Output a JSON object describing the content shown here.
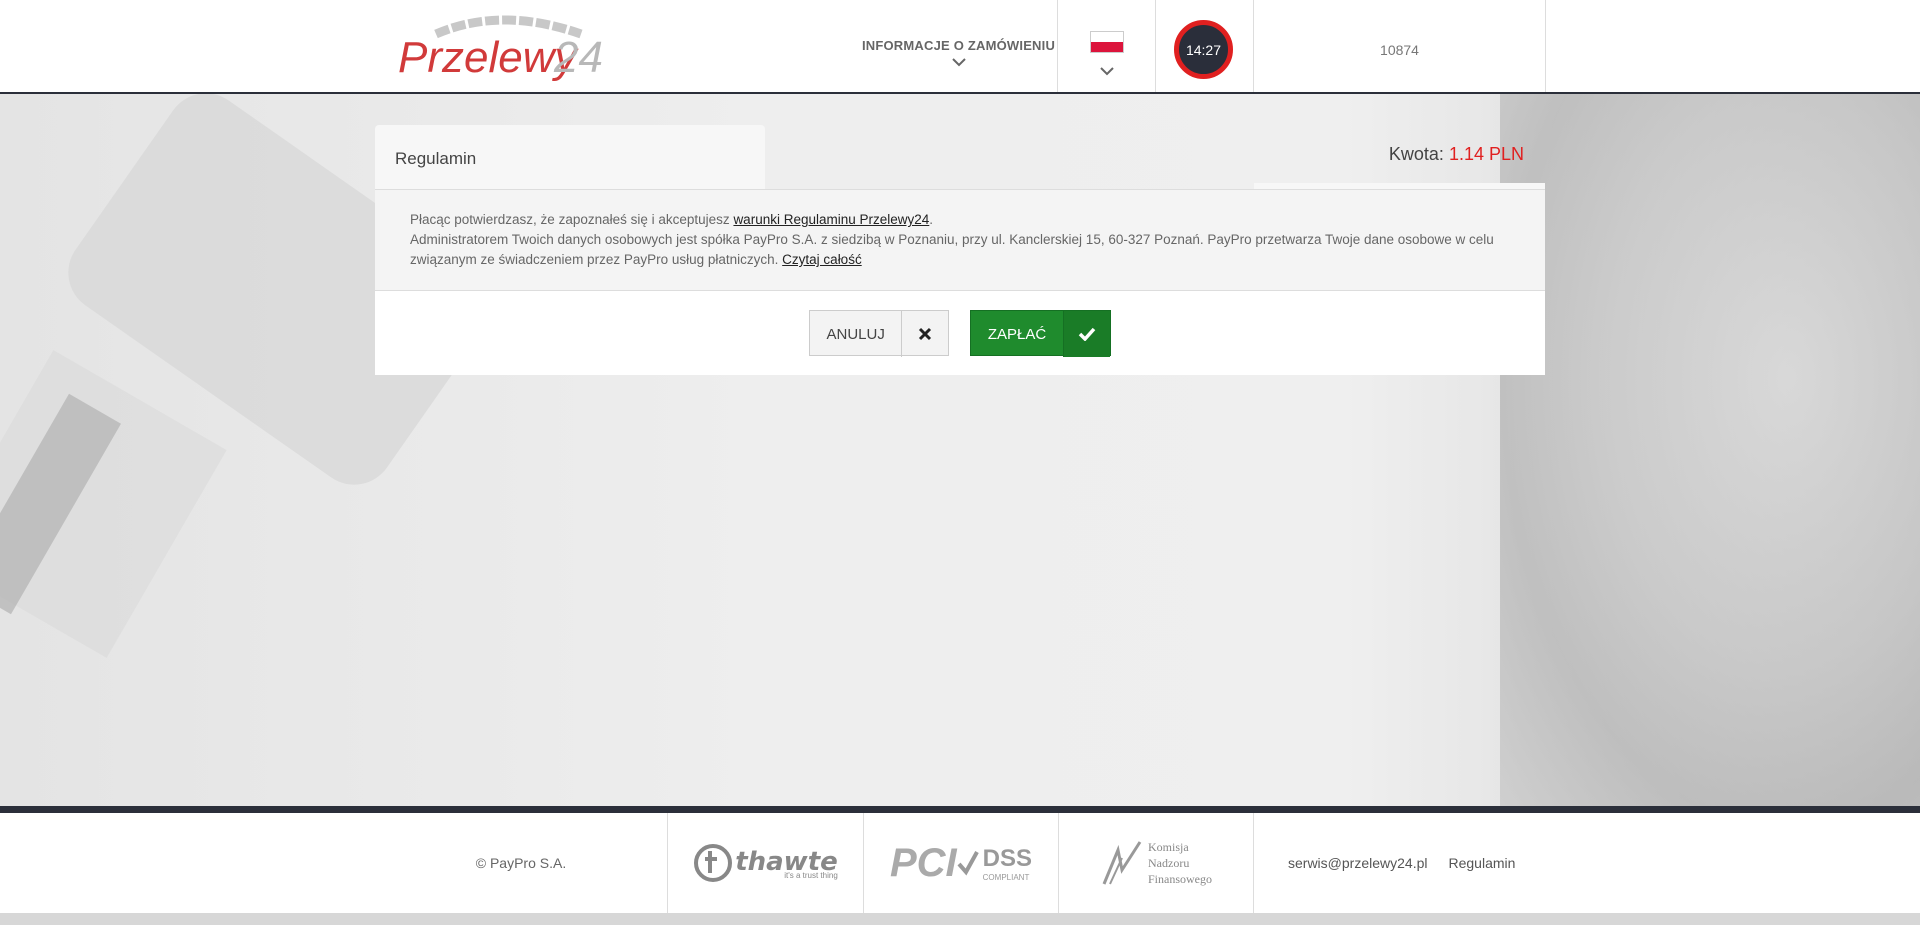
{
  "header": {
    "logo_text": "Przelewy24",
    "order_info_label": "INFORMACJE O ZAMÓWIENIU",
    "timer": "14:27",
    "session_id": "10874"
  },
  "panel": {
    "tab_label": "Regulamin",
    "amount_label": "Kwota:",
    "amount_value": "1.14 PLN",
    "terms_line1_prefix": "Płacąc potwierdzasz, że zapoznałeś się i akceptujesz",
    "terms_link": "warunki Regulaminu Przelewy24",
    "terms_line1_suffix": ".",
    "terms_line2": "Administratorem Twoich danych osobowych jest spółka PayPro S.A. z siedzibą w Poznaniu, przy ul. Kanclerskiej 15, 60-327 Poznań. PayPro przetwarza Twoje dane osobowe w celu związanym ze świadczeniem przez PayPro usług płatniczych.",
    "read_all_link": "Czytaj całość",
    "cancel_label": "ANULUJ",
    "pay_label": "ZAPŁAĆ"
  },
  "footer": {
    "copyright": "© PayPro S.A.",
    "thawte": "thawte",
    "thawte_tagline": "it's a trust thing",
    "pci": "PCI",
    "dss": "DSS",
    "dss_sub": "COMPLIANT",
    "knf_line1": "Komisja",
    "knf_line2": "Nadzoru",
    "knf_line3": "Finansowego",
    "email": "serwis@przelewy24.pl",
    "terms_link": "Regulamin"
  },
  "colors": {
    "accent_red": "#e02020",
    "pay_green": "#1f8b2d",
    "dark": "#2b2f3a"
  }
}
